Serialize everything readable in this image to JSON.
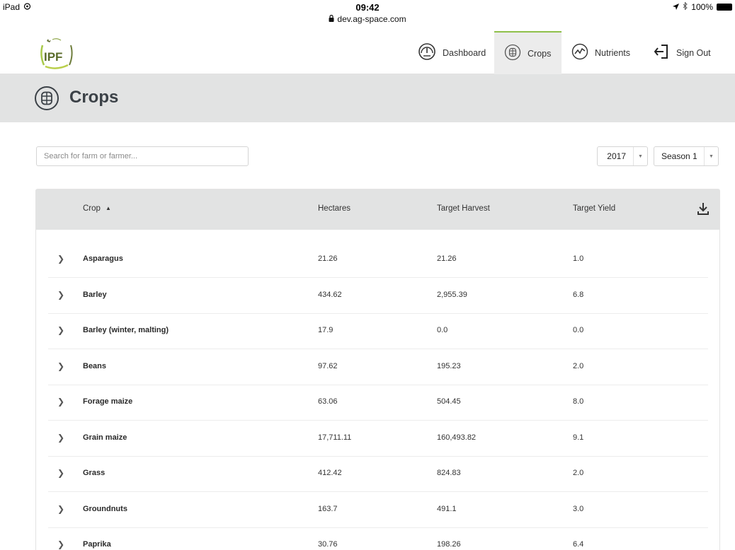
{
  "status_bar": {
    "device": "iPad",
    "time": "09:42",
    "url": "dev.ag-space.com",
    "battery": "100%"
  },
  "logo": {
    "text": "IPF"
  },
  "nav": [
    {
      "label": "Dashboard",
      "icon": "gauge-icon"
    },
    {
      "label": "Crops",
      "icon": "crops-icon",
      "active": true
    },
    {
      "label": "Nutrients",
      "icon": "nutrients-icon"
    },
    {
      "label": "Sign Out",
      "icon": "sign-out-icon"
    }
  ],
  "page": {
    "title": "Crops"
  },
  "search": {
    "placeholder": "Search for farm or farmer..."
  },
  "filters": {
    "year": "2017",
    "season": "Season 1"
  },
  "table": {
    "columns": [
      "Crop",
      "Hectares",
      "Target Harvest",
      "Target Yield"
    ],
    "rows": [
      {
        "crop": "Asparagus",
        "hectares": "21.26",
        "harvest": "21.26",
        "yield": "1.0"
      },
      {
        "crop": "Barley",
        "hectares": "434.62",
        "harvest": "2,955.39",
        "yield": "6.8"
      },
      {
        "crop": "Barley (winter, malting)",
        "hectares": "17.9",
        "harvest": "0.0",
        "yield": "0.0"
      },
      {
        "crop": "Beans",
        "hectares": "97.62",
        "harvest": "195.23",
        "yield": "2.0"
      },
      {
        "crop": "Forage maize",
        "hectares": "63.06",
        "harvest": "504.45",
        "yield": "8.0"
      },
      {
        "crop": "Grain maize",
        "hectares": "17,711.11",
        "harvest": "160,493.82",
        "yield": "9.1"
      },
      {
        "crop": "Grass",
        "hectares": "412.42",
        "harvest": "824.83",
        "yield": "2.0"
      },
      {
        "crop": "Groundnuts",
        "hectares": "163.7",
        "harvest": "491.1",
        "yield": "3.0"
      },
      {
        "crop": "Paprika",
        "hectares": "30.76",
        "harvest": "198.26",
        "yield": "6.4"
      }
    ]
  },
  "colors": {
    "accent": "#8fc04a",
    "band": "#e2e3e3",
    "title": "#3b4147"
  }
}
